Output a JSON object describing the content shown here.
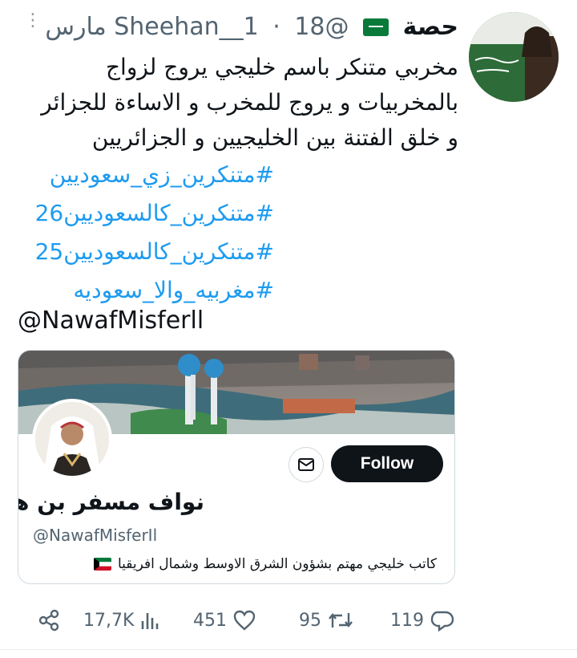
{
  "tweet": {
    "author_name": "حصة",
    "handle": "@Sheehan__1",
    "date": "18 مارس",
    "text_lines": [
      "مخربي متنكر باسم خليجي يروج لزواج",
      "بالمخربيات و يروج للمخرب و الاساءة للجزائر",
      "و خلق الفتنة بين الخليجيين و الجزائريين"
    ],
    "hashtags": [
      "#متنكرين_زي_سعوديين",
      "#متنكرين_كالسعوديين26",
      "#متنكرين_كالسعوديين25",
      "#مغربيه_والا_سعوديه"
    ],
    "mention": "@NawafMisferll"
  },
  "card": {
    "follow_label": "Follow",
    "name": "نواف مسفر بن هلال",
    "handle": "@NawafMisferIl",
    "bio": "كاتب خليجي مهتم بشؤون الشرق الاوسط وشمال افريقيا"
  },
  "actions": {
    "views": "17,7K",
    "likes": "451",
    "retweets": "95",
    "replies": "119"
  },
  "colors": {
    "hashtag": "#1d9bf0",
    "follow_bg": "#0f1419",
    "muted": "#536471"
  },
  "icons": [
    "more-icon",
    "saudi-flag-icon",
    "mail-icon",
    "kuwait-flag-icon",
    "share-icon",
    "views-icon",
    "like-icon",
    "retweet-icon",
    "reply-icon"
  ]
}
